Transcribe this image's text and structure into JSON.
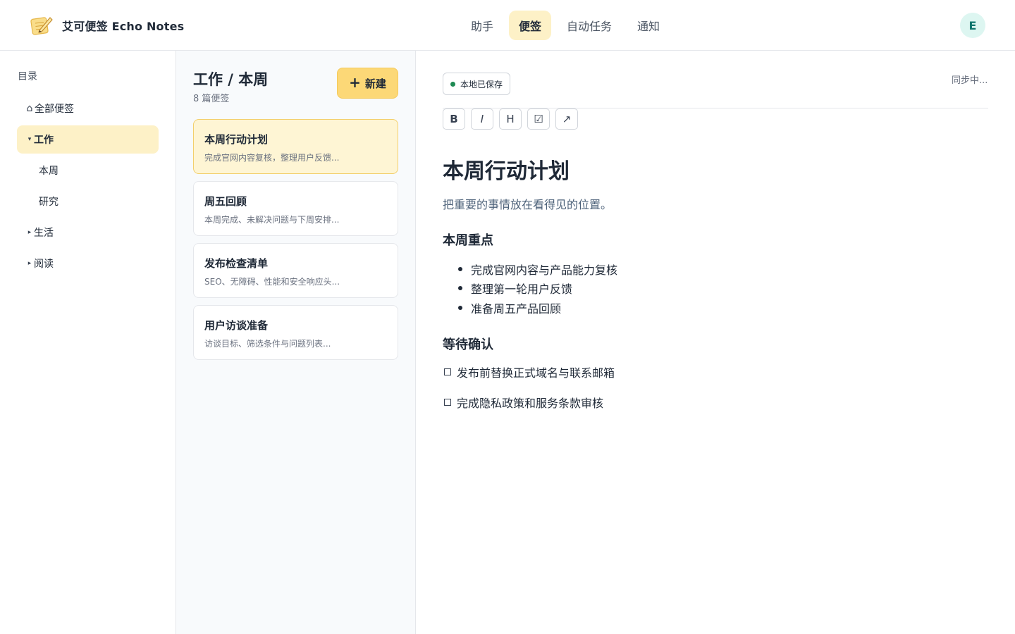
{
  "header": {
    "app_name": "艾可便签 Echo Notes",
    "logo_icon": "notepad-pencil-icon",
    "nav": [
      {
        "label": "助手",
        "active": false
      },
      {
        "label": "便签",
        "active": true
      },
      {
        "label": "自动任务",
        "active": false
      },
      {
        "label": "通知",
        "active": false
      }
    ],
    "avatar_initial": "E"
  },
  "sidebar": {
    "heading": "目录",
    "items": [
      {
        "glyph": "⌂",
        "label": "全部便签",
        "icon": "home-icon"
      },
      {
        "glyph": "▾",
        "label": "工作",
        "icon": "caret-down-icon",
        "active": true
      },
      {
        "label": "本周"
      },
      {
        "label": "研究"
      },
      {
        "glyph": "▸",
        "label": "生活",
        "icon": "caret-right-icon"
      },
      {
        "glyph": "▸",
        "label": "阅读",
        "icon": "caret-right-icon"
      }
    ]
  },
  "list": {
    "title": "工作 / 本周",
    "count": "8 篇便签",
    "new_label": "新建",
    "new_icon": "plus-icon",
    "notes": [
      {
        "title": "本周行动计划",
        "snippet": "完成官网内容复核，整理用户反馈...",
        "active": true
      },
      {
        "title": "周五回顾",
        "snippet": "本周完成、未解决问题与下周安排..."
      },
      {
        "title": "发布检查清单",
        "snippet": "SEO、无障碍、性能和安全响应头..."
      },
      {
        "title": "用户访谈准备",
        "snippet": "访谈目标、筛选条件与问题列表..."
      }
    ]
  },
  "editor": {
    "save_status": "本地已保存",
    "save_status_color": "#1e8a53",
    "sync_status": "同步中...",
    "toolbar": [
      {
        "label": "B",
        "icon": "bold-icon"
      },
      {
        "label": "I",
        "icon": "italic-icon"
      },
      {
        "label": "H",
        "icon": "heading-icon"
      },
      {
        "label": "☑",
        "icon": "checkbox-icon"
      },
      {
        "label": "↗",
        "icon": "link-arrow-icon"
      }
    ],
    "title": "本周行动计划",
    "subtitle": "把重要的事情放在看得见的位置。",
    "section1": "本周重点",
    "bullets": [
      "完成官网内容与产品能力复核",
      "整理第一轮用户反馈",
      "准备周五产品回顾"
    ],
    "section2": "等待确认",
    "checks": [
      "发布前替换正式域名与联系邮箱",
      "完成隐私政策和服务条款审核"
    ]
  },
  "colors": {
    "accent": "#fcd877",
    "accent_soft": "#fdf1c7",
    "avatar_bg": "#ddf6f1",
    "avatar_fg": "#0f766e"
  }
}
